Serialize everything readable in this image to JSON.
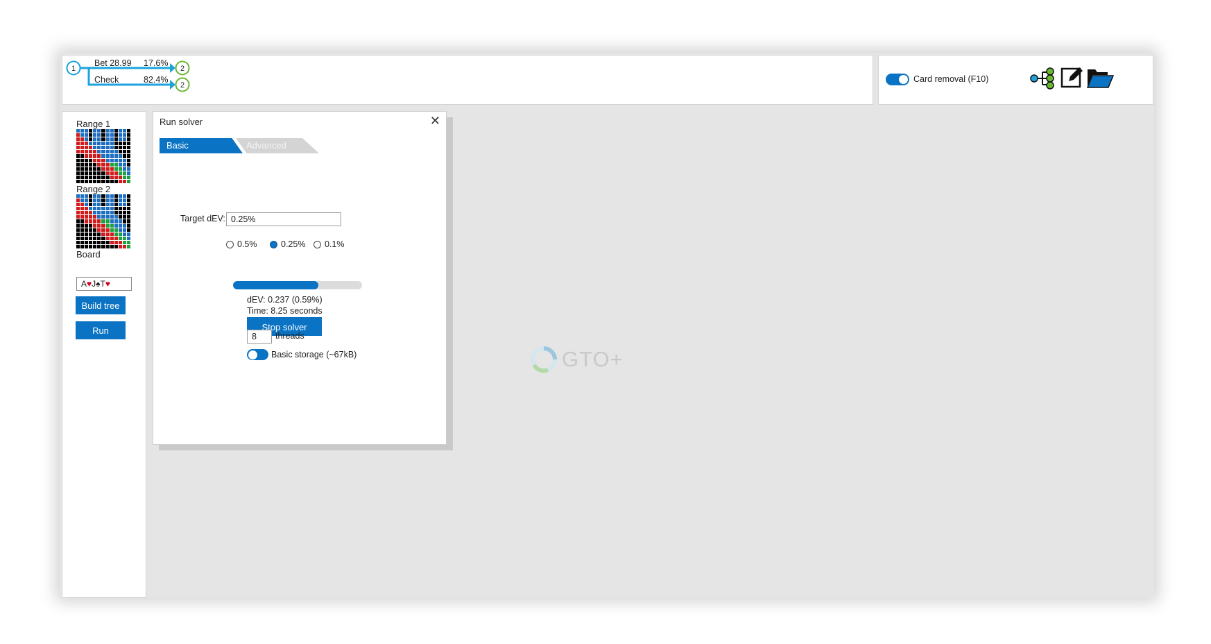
{
  "tree": {
    "root_node": "1",
    "branches": [
      {
        "label": "Bet 28.99",
        "freq": "17.6%",
        "target": "2"
      },
      {
        "label": "Check",
        "freq": "82.4%",
        "target": "2"
      }
    ]
  },
  "options": {
    "card_removal_label": "Card removal (F10)",
    "card_removal_on": true,
    "icons": [
      "tree-icon",
      "edit-icon",
      "folder-open-icon"
    ]
  },
  "left": {
    "range1_label": "Range 1",
    "range2_label": "Range 2",
    "board_label": "Board",
    "board_cards": [
      {
        "rank": "A",
        "suit": "♥",
        "color": "#d0021b"
      },
      {
        "rank": "J",
        "suit": "♠",
        "color": "#222222"
      },
      {
        "rank": "T",
        "suit": "♥",
        "color": "#d0021b"
      }
    ],
    "build_tree_label": "Build tree",
    "run_solver_label": "Run solver"
  },
  "dialog": {
    "title": "Run solver",
    "tabs": [
      {
        "label": "Basic",
        "active": true
      },
      {
        "label": "Advanced",
        "active": false
      }
    ],
    "target_dev_label": "Target dEV:",
    "target_dev_value": "0.25%",
    "radio_options": [
      {
        "label": "0.5%",
        "selected": false
      },
      {
        "label": "0.25%",
        "selected": true
      },
      {
        "label": "0.1%",
        "selected": false
      }
    ],
    "progress_fraction": 0.66,
    "dev_text": "dEV: 0.237 (0.59%)",
    "time_text": "Time: 8.25 seconds",
    "stop_label": "Stop solver",
    "threads_value": "8",
    "threads_label": "threads",
    "storage_label": "Basic storage (~67kB)",
    "storage_on": true
  },
  "watermark": {
    "text": "GTO+"
  },
  "colors": {
    "accent": "#0a73c4",
    "tree_line": "#1aa3dd",
    "tree_node_child": "#6ab832",
    "range_blue": "#1f6fc0",
    "range_red": "#d01c1c",
    "range_green": "#1fa040",
    "range_black": "#000000"
  }
}
